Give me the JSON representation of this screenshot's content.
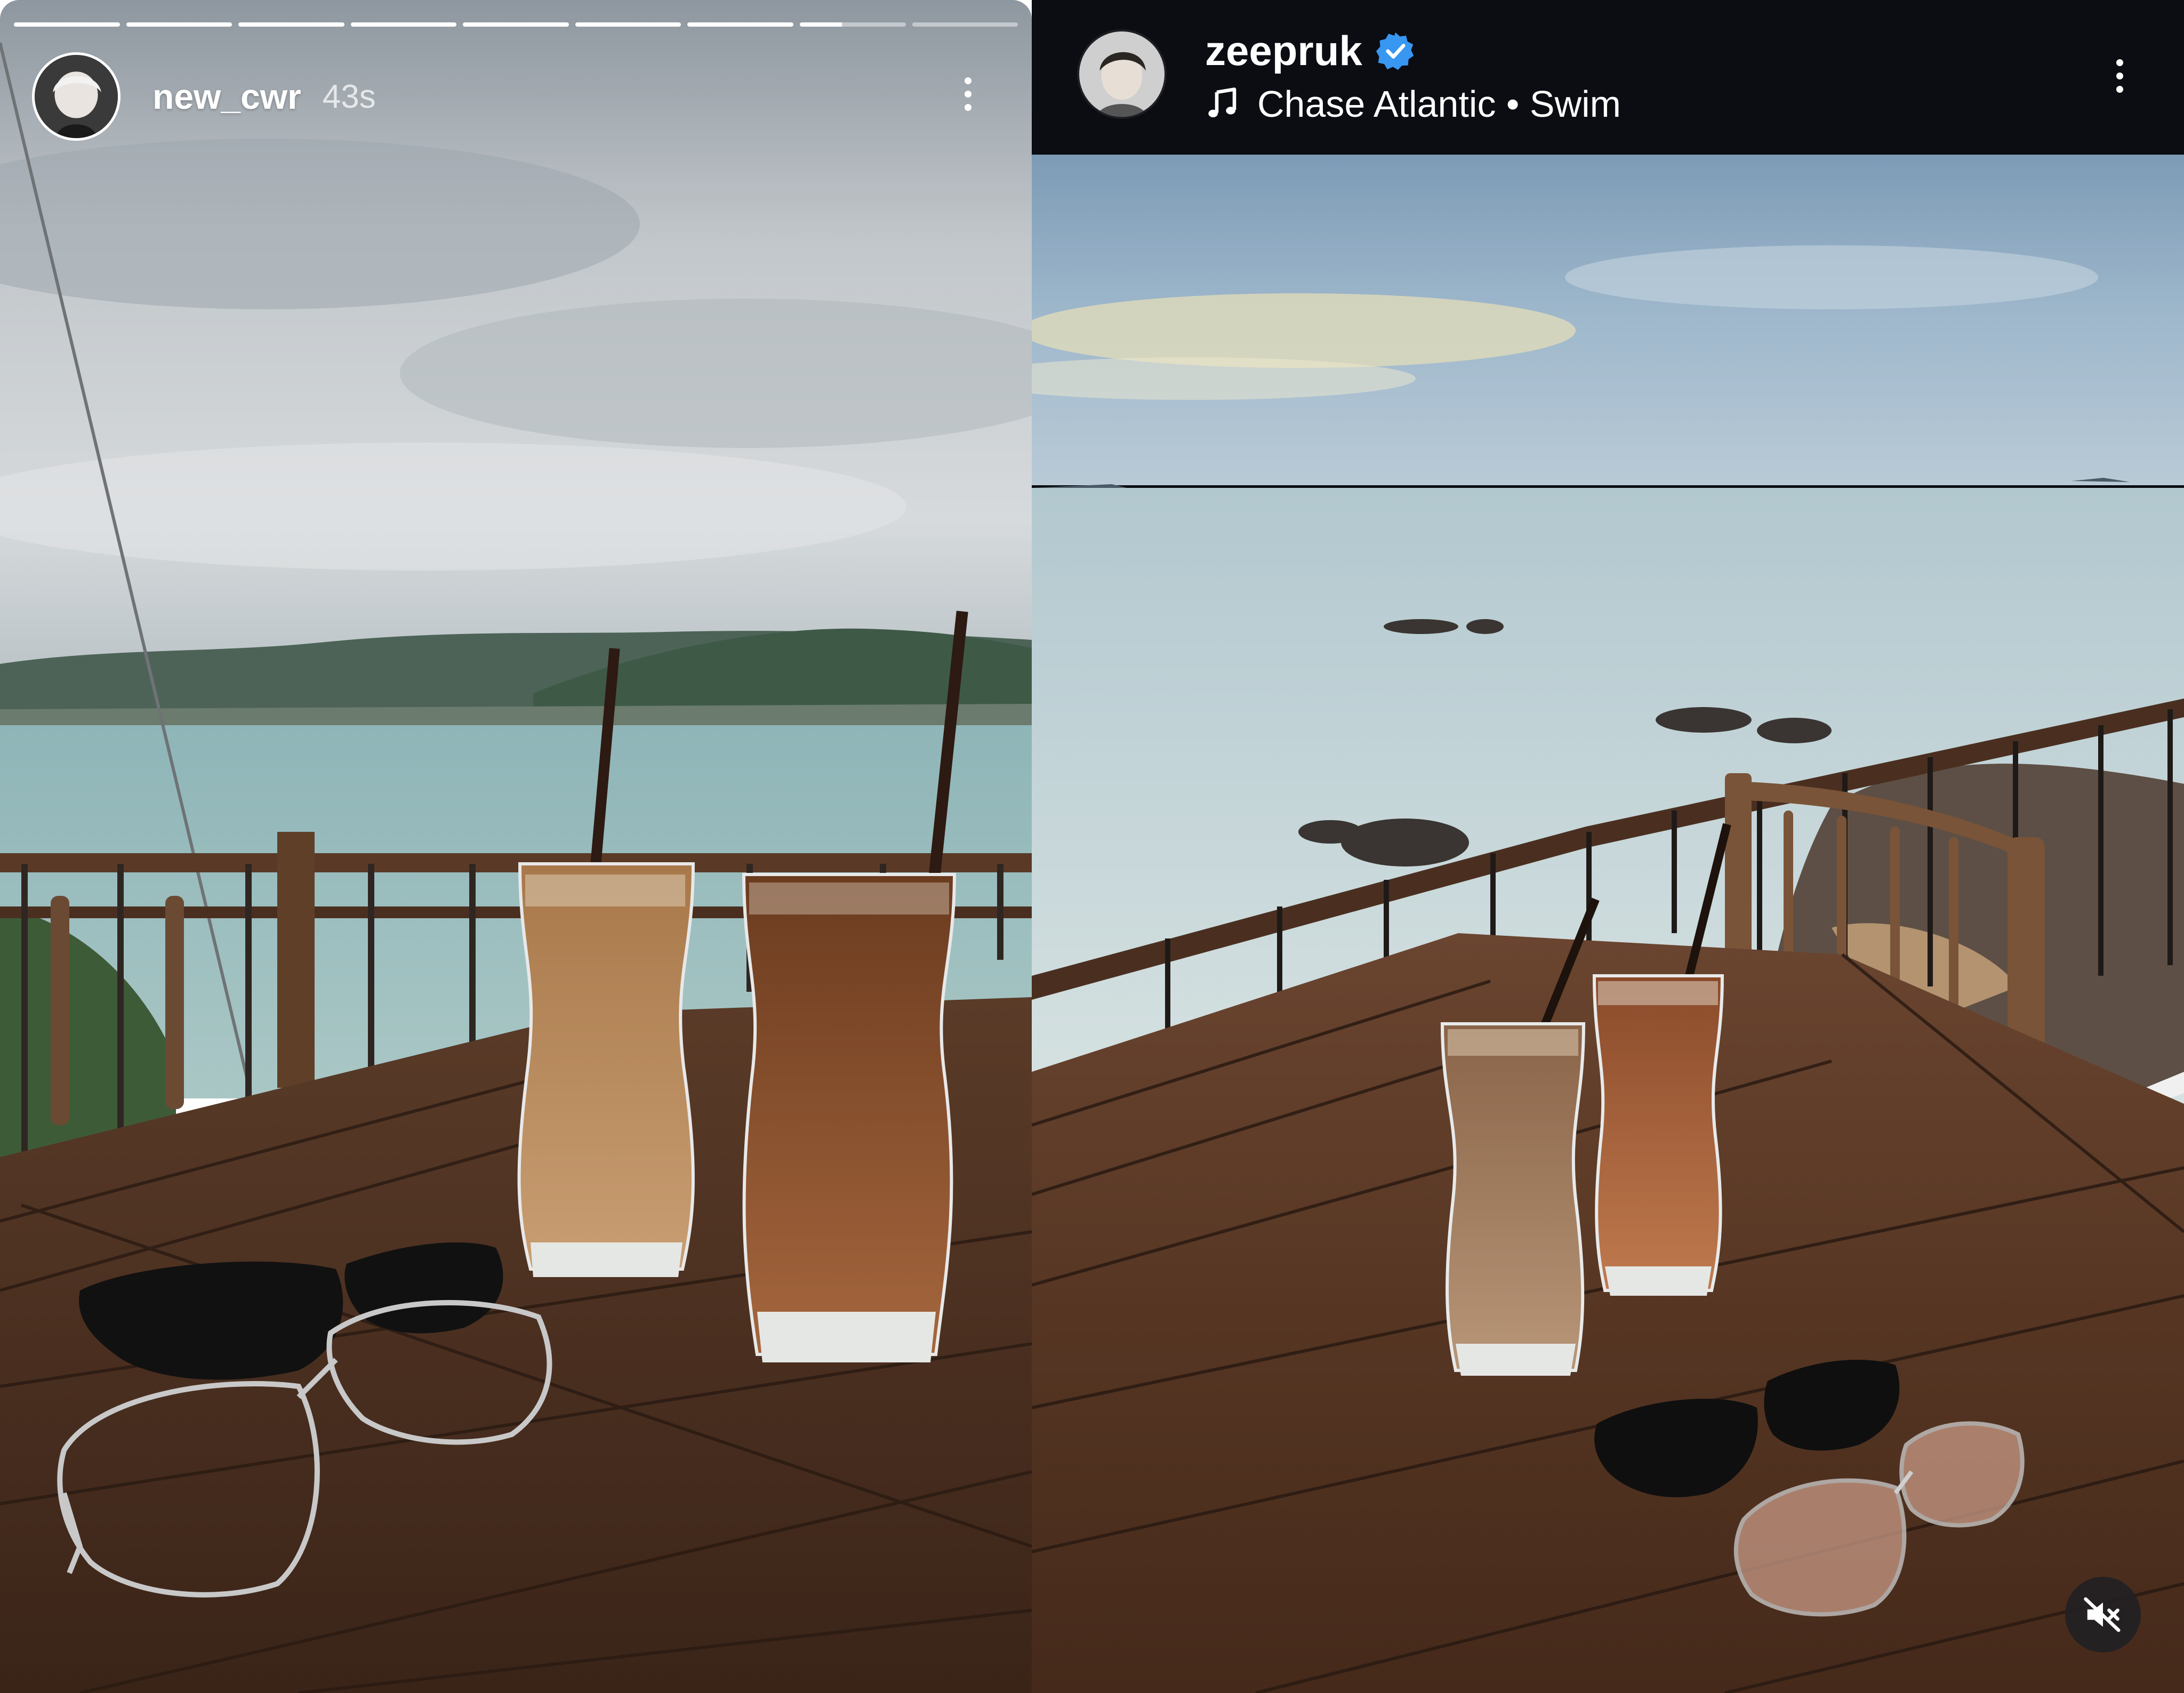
{
  "left_story": {
    "username": "new_cwr",
    "time_ago": "43s",
    "progress_segments": [
      1,
      1,
      1,
      1,
      1,
      1,
      1,
      0.4,
      0
    ],
    "more_icon": "more-vertical-icon"
  },
  "right_post": {
    "username": "zeepruk",
    "verified": true,
    "verified_icon": "verified-badge-icon",
    "music_icon": "music-note-icon",
    "music_label": "Chase Atlantic • Swim",
    "more_icon": "more-vertical-icon",
    "mute_icon": "speaker-muted-icon"
  },
  "colors": {
    "verified_blue": "#3897f0",
    "right_header_bg": "#0b0d12",
    "text_white": "#ffffff"
  }
}
